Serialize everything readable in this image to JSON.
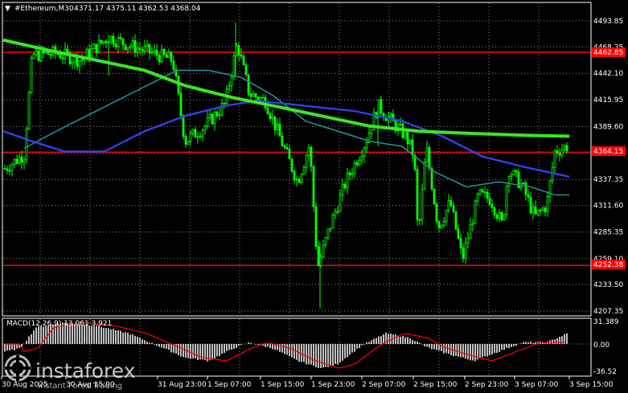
{
  "header": {
    "arrow": "▼",
    "symbol": "#Ethereum,M30",
    "ohlc": "4371.17 4375.11 4362.53 4368.04"
  },
  "colors": {
    "background": "#000000",
    "grid": "#ffffff",
    "candles": "#00ff00",
    "ma_slow": "#39e81e",
    "ma_mid": "#2e43e6",
    "ma_fast": "#1f8f8f",
    "support_resistance": "#ff0000",
    "macd_histogram": "#c0c0c0",
    "macd_signal": "#ff0000"
  },
  "price_axis": {
    "ticks": [
      "4493.85",
      "4468.25",
      "4442.10",
      "4415.95",
      "4389.60",
      "4363.50",
      "4337.35",
      "4311.60",
      "4285.35",
      "4259.10",
      "4233.50",
      "4207.35"
    ]
  },
  "levels": [
    {
      "name": "resistance",
      "price": "4462.85"
    },
    {
      "name": "current",
      "price": "4364.15"
    },
    {
      "name": "support",
      "price": "4252.38"
    }
  ],
  "macd_panel": {
    "label": "MACD(12,26,9) 13.061 3.921",
    "ticks": [
      "31.389",
      "0.00",
      "-36.52"
    ]
  },
  "time_axis": {
    "labels": [
      "30 Aug 2025",
      "30 Aug 15:00",
      "31 Aug 23:00",
      "1 Sep 07:00",
      "1 Sep 15:00",
      "1 Sep 23:00",
      "2 Sep 07:00",
      "2 Sep 15:00",
      "2 Sep 23:00",
      "3 Sep 07:00",
      "3 Sep 15:00"
    ]
  },
  "watermark": {
    "brand": "instaforex",
    "tagline": "Instant Forex Trading"
  }
}
